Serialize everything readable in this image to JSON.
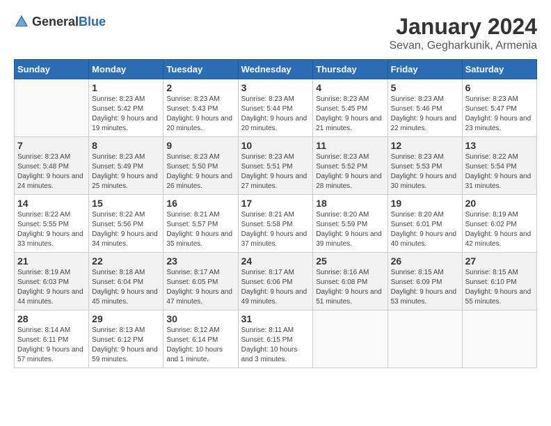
{
  "header": {
    "logo_general": "General",
    "logo_blue": "Blue",
    "month_title": "January 2024",
    "location": "Sevan, Gegharkunik, Armenia"
  },
  "days_of_week": [
    "Sunday",
    "Monday",
    "Tuesday",
    "Wednesday",
    "Thursday",
    "Friday",
    "Saturday"
  ],
  "weeks": [
    [
      {
        "day": "",
        "sunrise": "",
        "sunset": "",
        "daylight": ""
      },
      {
        "day": "1",
        "sunrise": "Sunrise: 8:23 AM",
        "sunset": "Sunset: 5:42 PM",
        "daylight": "Daylight: 9 hours and 19 minutes."
      },
      {
        "day": "2",
        "sunrise": "Sunrise: 8:23 AM",
        "sunset": "Sunset: 5:43 PM",
        "daylight": "Daylight: 9 hours and 20 minutes."
      },
      {
        "day": "3",
        "sunrise": "Sunrise: 8:23 AM",
        "sunset": "Sunset: 5:44 PM",
        "daylight": "Daylight: 9 hours and 20 minutes."
      },
      {
        "day": "4",
        "sunrise": "Sunrise: 8:23 AM",
        "sunset": "Sunset: 5:45 PM",
        "daylight": "Daylight: 9 hours and 21 minutes."
      },
      {
        "day": "5",
        "sunrise": "Sunrise: 8:23 AM",
        "sunset": "Sunset: 5:46 PM",
        "daylight": "Daylight: 9 hours and 22 minutes."
      },
      {
        "day": "6",
        "sunrise": "Sunrise: 8:23 AM",
        "sunset": "Sunset: 5:47 PM",
        "daylight": "Daylight: 9 hours and 23 minutes."
      }
    ],
    [
      {
        "day": "7",
        "sunrise": "Sunrise: 8:23 AM",
        "sunset": "Sunset: 5:48 PM",
        "daylight": "Daylight: 9 hours and 24 minutes."
      },
      {
        "day": "8",
        "sunrise": "Sunrise: 8:23 AM",
        "sunset": "Sunset: 5:49 PM",
        "daylight": "Daylight: 9 hours and 25 minutes."
      },
      {
        "day": "9",
        "sunrise": "Sunrise: 8:23 AM",
        "sunset": "Sunset: 5:50 PM",
        "daylight": "Daylight: 9 hours and 26 minutes."
      },
      {
        "day": "10",
        "sunrise": "Sunrise: 8:23 AM",
        "sunset": "Sunset: 5:51 PM",
        "daylight": "Daylight: 9 hours and 27 minutes."
      },
      {
        "day": "11",
        "sunrise": "Sunrise: 8:23 AM",
        "sunset": "Sunset: 5:52 PM",
        "daylight": "Daylight: 9 hours and 28 minutes."
      },
      {
        "day": "12",
        "sunrise": "Sunrise: 8:23 AM",
        "sunset": "Sunset: 5:53 PM",
        "daylight": "Daylight: 9 hours and 30 minutes."
      },
      {
        "day": "13",
        "sunrise": "Sunrise: 8:22 AM",
        "sunset": "Sunset: 5:54 PM",
        "daylight": "Daylight: 9 hours and 31 minutes."
      }
    ],
    [
      {
        "day": "14",
        "sunrise": "Sunrise: 8:22 AM",
        "sunset": "Sunset: 5:55 PM",
        "daylight": "Daylight: 9 hours and 33 minutes."
      },
      {
        "day": "15",
        "sunrise": "Sunrise: 8:22 AM",
        "sunset": "Sunset: 5:56 PM",
        "daylight": "Daylight: 9 hours and 34 minutes."
      },
      {
        "day": "16",
        "sunrise": "Sunrise: 8:21 AM",
        "sunset": "Sunset: 5:57 PM",
        "daylight": "Daylight: 9 hours and 35 minutes."
      },
      {
        "day": "17",
        "sunrise": "Sunrise: 8:21 AM",
        "sunset": "Sunset: 5:58 PM",
        "daylight": "Daylight: 9 hours and 37 minutes."
      },
      {
        "day": "18",
        "sunrise": "Sunrise: 8:20 AM",
        "sunset": "Sunset: 5:59 PM",
        "daylight": "Daylight: 9 hours and 39 minutes."
      },
      {
        "day": "19",
        "sunrise": "Sunrise: 8:20 AM",
        "sunset": "Sunset: 6:01 PM",
        "daylight": "Daylight: 9 hours and 40 minutes."
      },
      {
        "day": "20",
        "sunrise": "Sunrise: 8:19 AM",
        "sunset": "Sunset: 6:02 PM",
        "daylight": "Daylight: 9 hours and 42 minutes."
      }
    ],
    [
      {
        "day": "21",
        "sunrise": "Sunrise: 8:19 AM",
        "sunset": "Sunset: 6:03 PM",
        "daylight": "Daylight: 9 hours and 44 minutes."
      },
      {
        "day": "22",
        "sunrise": "Sunrise: 8:18 AM",
        "sunset": "Sunset: 6:04 PM",
        "daylight": "Daylight: 9 hours and 45 minutes."
      },
      {
        "day": "23",
        "sunrise": "Sunrise: 8:17 AM",
        "sunset": "Sunset: 6:05 PM",
        "daylight": "Daylight: 9 hours and 47 minutes."
      },
      {
        "day": "24",
        "sunrise": "Sunrise: 8:17 AM",
        "sunset": "Sunset: 6:06 PM",
        "daylight": "Daylight: 9 hours and 49 minutes."
      },
      {
        "day": "25",
        "sunrise": "Sunrise: 8:16 AM",
        "sunset": "Sunset: 6:08 PM",
        "daylight": "Daylight: 9 hours and 51 minutes."
      },
      {
        "day": "26",
        "sunrise": "Sunrise: 8:15 AM",
        "sunset": "Sunset: 6:09 PM",
        "daylight": "Daylight: 9 hours and 53 minutes."
      },
      {
        "day": "27",
        "sunrise": "Sunrise: 8:15 AM",
        "sunset": "Sunset: 6:10 PM",
        "daylight": "Daylight: 9 hours and 55 minutes."
      }
    ],
    [
      {
        "day": "28",
        "sunrise": "Sunrise: 8:14 AM",
        "sunset": "Sunset: 6:11 PM",
        "daylight": "Daylight: 9 hours and 57 minutes."
      },
      {
        "day": "29",
        "sunrise": "Sunrise: 8:13 AM",
        "sunset": "Sunset: 6:12 PM",
        "daylight": "Daylight: 9 hours and 59 minutes."
      },
      {
        "day": "30",
        "sunrise": "Sunrise: 8:12 AM",
        "sunset": "Sunset: 6:14 PM",
        "daylight": "Daylight: 10 hours and 1 minute."
      },
      {
        "day": "31",
        "sunrise": "Sunrise: 8:11 AM",
        "sunset": "Sunset: 6:15 PM",
        "daylight": "Daylight: 10 hours and 3 minutes."
      },
      {
        "day": "",
        "sunrise": "",
        "sunset": "",
        "daylight": ""
      },
      {
        "day": "",
        "sunrise": "",
        "sunset": "",
        "daylight": ""
      },
      {
        "day": "",
        "sunrise": "",
        "sunset": "",
        "daylight": ""
      }
    ]
  ]
}
